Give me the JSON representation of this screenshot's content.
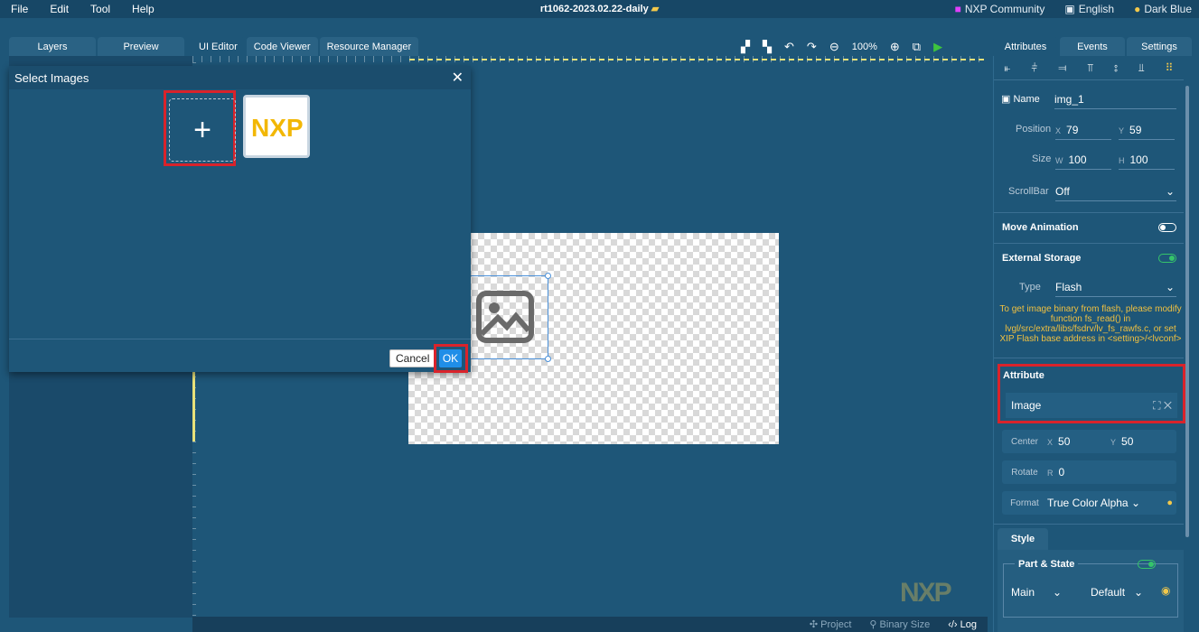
{
  "menubar": {
    "items": [
      "File",
      "Edit",
      "Tool",
      "Help"
    ],
    "title": "rt1062-2023.02.22-daily",
    "community": "NXP Community",
    "language": "English",
    "theme": "Dark Blue"
  },
  "left_tabs": [
    "Layers",
    "Preview"
  ],
  "editor_tabs": [
    "UI Editor",
    "Code Viewer",
    "Resource Manager"
  ],
  "toolbar": {
    "zoom": "100%"
  },
  "right_tabs": [
    "Attributes",
    "Events",
    "Settings"
  ],
  "dialog": {
    "title": "Select Images",
    "add_symbol": "+",
    "image_label": "NXP",
    "cancel": "Cancel",
    "ok": "OK"
  },
  "status": {
    "project": "Project",
    "binary_size": "Binary Size",
    "log": "Log"
  },
  "watermark": "NXP",
  "attributes": {
    "name_label": "Name",
    "name_value": "img_1",
    "position_label": "Position",
    "x_label": "X",
    "x": "79",
    "y_label": "Y",
    "y": "59",
    "size_label": "Size",
    "w_label": "W",
    "w": "100",
    "h_label": "H",
    "h": "100",
    "scrollbar_label": "ScrollBar",
    "scrollbar_value": "Off",
    "move_animation": "Move Animation",
    "external_storage": "External Storage",
    "type_label": "Type",
    "type_value": "Flash",
    "note": "To get image binary from flash, please modify function fs_read() in lvgl/src/extra/libs/fsdrv/lv_fs_rawfs.c, or set XIP Flash base address in <setting>/<lvconf>",
    "attribute_title": "Attribute",
    "image_label": "Image",
    "center_label": "Center",
    "center_x": "50",
    "center_y": "50",
    "rotate_label": "Rotate",
    "rotate_r_label": "R",
    "rotate_value": "0",
    "format_label": "Format",
    "format_value": "True Color Alpha",
    "style_tab": "Style",
    "part_state_label": "Part & State",
    "part_value": "Main",
    "state_value": "Default"
  }
}
